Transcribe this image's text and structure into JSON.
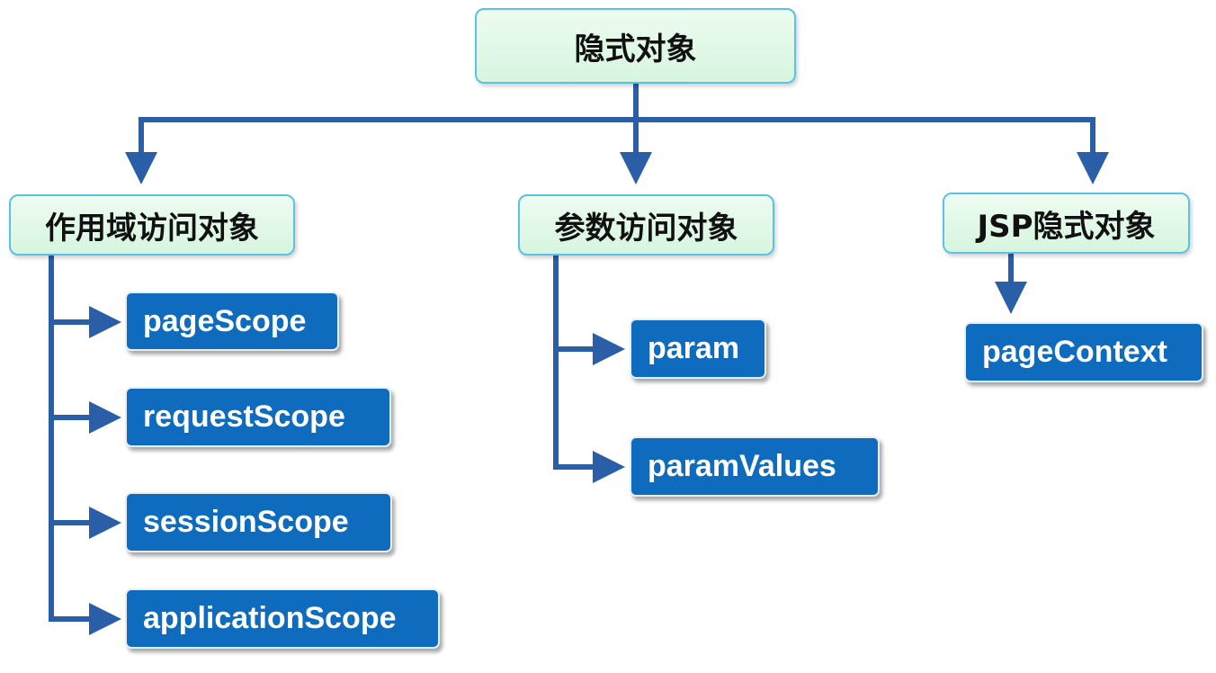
{
  "root": {
    "label": "隐式对象"
  },
  "categories": [
    {
      "label": "作用域访问对象"
    },
    {
      "label": "参数访问对象"
    },
    {
      "label": "JSP隐式对象"
    }
  ],
  "scope_objects": [
    {
      "label": "pageScope"
    },
    {
      "label": "requestScope"
    },
    {
      "label": "sessionScope"
    },
    {
      "label": "applicationScope"
    }
  ],
  "param_objects": [
    {
      "label": "param"
    },
    {
      "label": "paramValues"
    }
  ],
  "jsp_objects": [
    {
      "label": "pageContext"
    }
  ],
  "colors": {
    "connector": "#2a5ea6",
    "category_fill": "#dcf7e2",
    "category_border": "#5cc1e6",
    "leaf_fill": "#0e6bbd",
    "leaf_text": "#ffffff"
  }
}
